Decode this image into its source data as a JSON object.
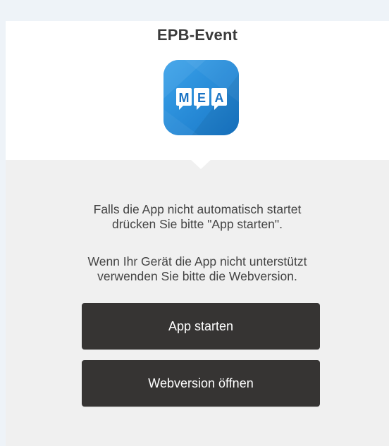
{
  "header": {
    "title": "EPB-Event",
    "app_icon": {
      "name": "mea-app-icon",
      "letters": [
        "M",
        "E",
        "A"
      ],
      "background_color": "#2a8fdc"
    }
  },
  "main": {
    "message_1": {
      "line1": "Falls die App nicht automatisch startet",
      "line2": "drücken Sie bitte \"App starten\"."
    },
    "message_2": {
      "line1": "Wenn Ihr Gerät die App nicht unterstützt",
      "line2": "verwenden Sie bitte die Webversion."
    },
    "buttons": {
      "start_app_label": "App starten",
      "open_web_label": "Webversion öffnen"
    }
  },
  "colors": {
    "page_background": "#eef3f8",
    "content_background": "#f0f0f0",
    "header_background": "#ffffff",
    "button_background": "#363433",
    "button_text": "#ffffff",
    "text": "#444444"
  }
}
